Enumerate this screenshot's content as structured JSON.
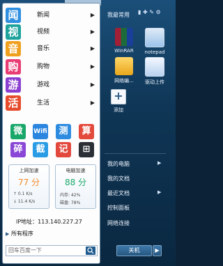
{
  "categories": [
    {
      "icon": "闻",
      "label": "新闻",
      "color": "#2f8fe0"
    },
    {
      "icon": "视",
      "label": "视频",
      "color": "#1da29d"
    },
    {
      "icon": "音",
      "label": "音乐",
      "color": "#f0a01f"
    },
    {
      "icon": "购",
      "label": "购物",
      "color": "#e83c73"
    },
    {
      "icon": "游",
      "label": "游戏",
      "color": "#8a3fd1"
    },
    {
      "icon": "活",
      "label": "生活",
      "color": "#e64b2c"
    }
  ],
  "tiles": [
    {
      "text": "微",
      "color": "#1aa76a"
    },
    {
      "text": "Wifi",
      "color": "#2b86e0"
    },
    {
      "text": "测",
      "color": "#2d8be0"
    },
    {
      "text": "算",
      "color": "#e34a3c"
    },
    {
      "text": "碎",
      "color": "#8a46d6"
    },
    {
      "text": "截",
      "color": "#2a9ce5"
    },
    {
      "text": "记",
      "color": "#e3483c"
    },
    {
      "text": "⊞",
      "color": "#2a2f36"
    }
  ],
  "cpu_box": {
    "title": "上网加速",
    "value": "77 分",
    "row1": "↑  0.1 K/s",
    "row2": "↓  11.4 K/s"
  },
  "mem_box": {
    "title": "电脑加速",
    "value": "88 分",
    "row1": "内存:    42%",
    "row2": "磁盘:    78%"
  },
  "ip_text": "IP地址：113.140.227.27",
  "all_programs": "所有程序",
  "search_placeholder": "回车百度一下",
  "right": {
    "frequent_label": "我最常用",
    "header_icons": "▮ ✚ ✎ ⚙",
    "apps": [
      {
        "name": "WinRAR"
      },
      {
        "name": "notepad"
      },
      {
        "name": "网络编..."
      },
      {
        "name": "驱动上传"
      },
      {
        "name": "添加"
      }
    ],
    "menu": [
      {
        "label": "我的电脑",
        "arrow": "▶"
      },
      {
        "label": "我的文档",
        "arrow": ""
      },
      {
        "label": "最近文档",
        "arrow": "▶"
      },
      {
        "label": "控制面板",
        "arrow": ""
      },
      {
        "label": "网络连接",
        "arrow": ""
      }
    ],
    "shutdown": "关机",
    "shutdown_arrow": "▶"
  },
  "colors": {
    "left_bg": "#fdfdfd",
    "right_bg": "#0f3656",
    "accent": "#2f8fe0"
  }
}
